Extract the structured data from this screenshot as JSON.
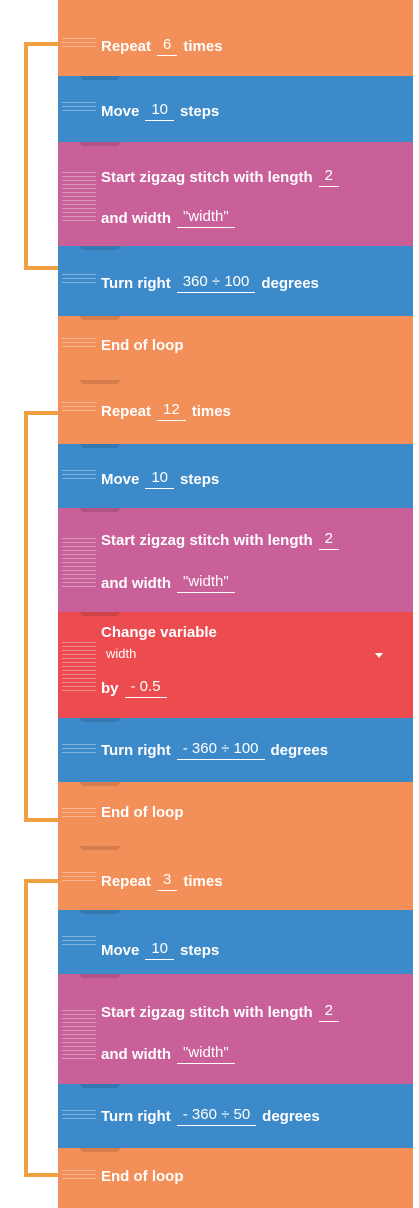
{
  "blocks": [
    {
      "type": "repeat",
      "label": "Repeat",
      "value": "6",
      "suffix": "times"
    },
    {
      "type": "move",
      "label": "Move",
      "value": "10",
      "suffix": "steps"
    },
    {
      "type": "zigzag",
      "label": "Start zigzag stitch with length",
      "length": "2",
      "width_label": "and width",
      "width_value": "\"width\""
    },
    {
      "type": "turn",
      "label": "Turn right",
      "value": "360 ÷ 100",
      "suffix": "degrees"
    },
    {
      "type": "end",
      "label": "End of loop"
    },
    {
      "type": "repeat",
      "label": "Repeat",
      "value": "12",
      "suffix": "times"
    },
    {
      "type": "move",
      "label": "Move",
      "value": "10",
      "suffix": "steps"
    },
    {
      "type": "zigzag",
      "label": "Start zigzag stitch with length",
      "length": "2",
      "width_label": "and width",
      "width_value": "\"width\""
    },
    {
      "type": "change",
      "label": "Change variable",
      "variable": "width",
      "by_label": "by",
      "by_value": "- 0.5"
    },
    {
      "type": "turn",
      "label": "Turn right",
      "value": "- 360 ÷ 100",
      "suffix": "degrees"
    },
    {
      "type": "end",
      "label": "End of loop"
    },
    {
      "type": "repeat",
      "label": "Repeat",
      "value": "3",
      "suffix": "times"
    },
    {
      "type": "move",
      "label": "Move",
      "value": "10",
      "suffix": "steps"
    },
    {
      "type": "zigzag",
      "label": "Start zigzag stitch with length",
      "length": "2",
      "width_label": "and width",
      "width_value": "\"width\""
    },
    {
      "type": "turn",
      "label": "Turn right",
      "value": "- 360 ÷ 50",
      "suffix": "degrees"
    },
    {
      "type": "end",
      "label": "End of loop"
    }
  ],
  "colors": {
    "repeat": "#f38f58",
    "move": "#3d8acb",
    "zigzag": "#c9609a",
    "change": "#ec4c4f",
    "bracket": "#f0a040"
  }
}
